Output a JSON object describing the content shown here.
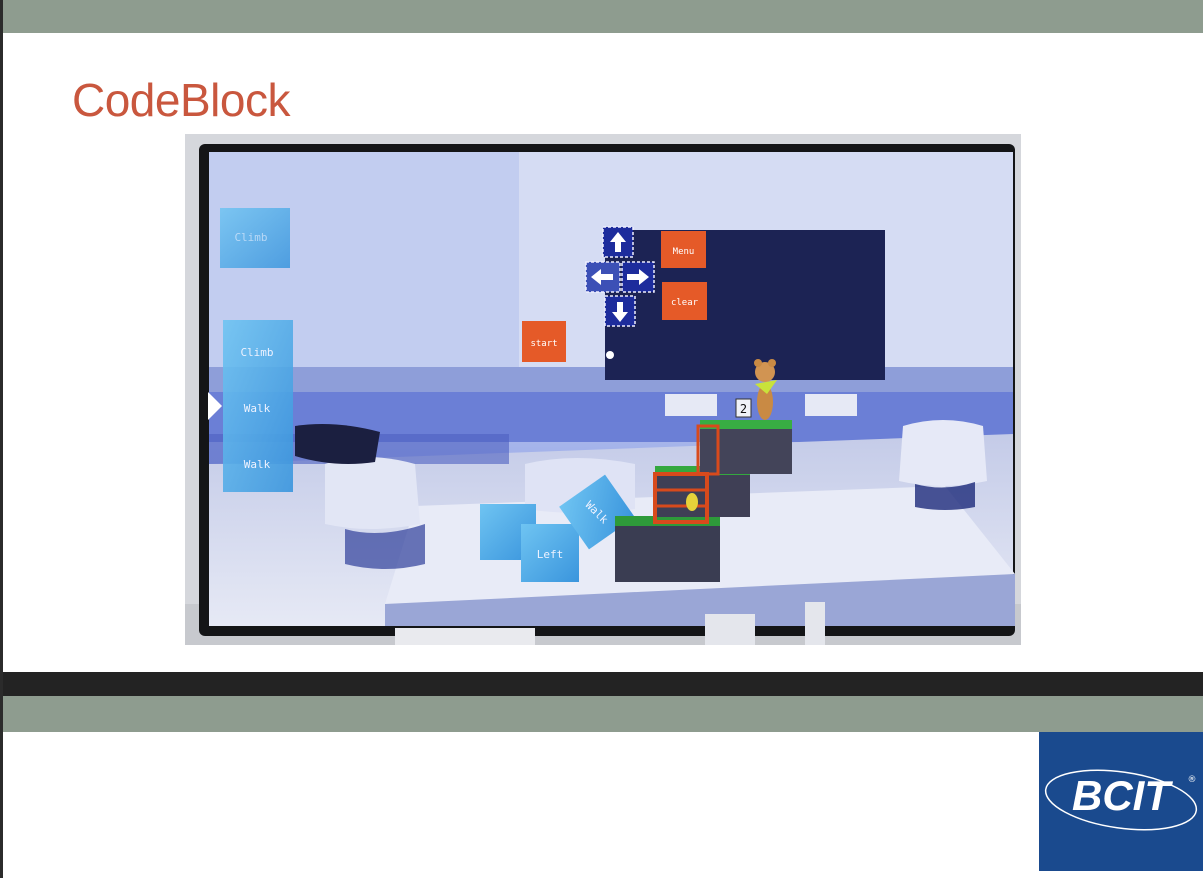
{
  "slide": {
    "title": "CodeBlock"
  },
  "game_screen": {
    "buttons": {
      "menu": "Menu",
      "clear": "clear",
      "start": "start"
    },
    "queue_blocks": [
      "Climb",
      "Climb",
      "Walk",
      "Walk"
    ],
    "cube_labels": [
      "Walk",
      "Left"
    ],
    "step_counter": "2",
    "arrows": [
      "up-arrow",
      "left-arrow",
      "right-arrow",
      "down-arrow"
    ]
  },
  "logo": {
    "text": "BCIT",
    "mark": "®"
  },
  "colors": {
    "title": "#c9573e",
    "band": "#8e9c8f",
    "logo_bg": "#1a4a8e",
    "orange_button": "#e55a28"
  }
}
